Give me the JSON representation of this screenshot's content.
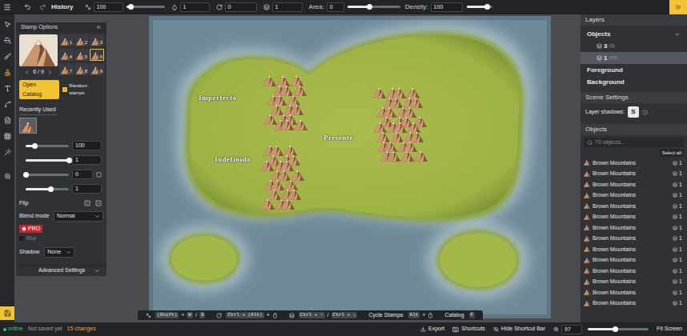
{
  "toolbar": {
    "history": "History",
    "size": {
      "value": "100",
      "level": 0.12
    },
    "opacity": "1",
    "rotation": "0",
    "layer": "1",
    "area": {
      "label": "Area:",
      "value": "0",
      "level": 0.42
    },
    "density": {
      "label": "Density:",
      "value": "100",
      "level": 0.8
    }
  },
  "tools": [
    {
      "selected": false
    },
    {
      "selected": false
    },
    {
      "selected": false
    },
    {
      "selected": true
    },
    {
      "selected": false
    },
    {
      "selected": false
    },
    {
      "selected": false
    },
    {
      "selected": false
    },
    {
      "selected": false
    },
    {
      "selected": false
    }
  ],
  "stamp_options": {
    "title": "Stamp Options",
    "counter": "6 / 9",
    "stamps": [
      {
        "label": "1",
        "selected": false
      },
      {
        "label": "2",
        "selected": false
      },
      {
        "label": "3",
        "selected": false
      },
      {
        "label": "4",
        "selected": false
      },
      {
        "label": "5",
        "selected": false
      },
      {
        "label": "6",
        "selected": true
      },
      {
        "label": "7",
        "selected": false
      },
      {
        "label": "8",
        "selected": false
      },
      {
        "label": "9",
        "selected": false
      }
    ],
    "open_catalog": "Open Catalog",
    "random_stamps": {
      "label": "Random stamps",
      "checked": true
    },
    "recently_used": "Recently Used",
    "size": {
      "value": "100",
      "level": 0.2
    },
    "opacity": {
      "value": "1",
      "level": 1
    },
    "rotation": {
      "value": "0",
      "level": 0
    },
    "layer": {
      "value": "1",
      "level": 0.58
    },
    "flip": "Flip",
    "blend_mode": {
      "label": "Blend mode",
      "value": "Normal"
    },
    "pro": "PRO",
    "blur": {
      "label": "Blur",
      "checked": false,
      "disabled": true
    },
    "shadow": {
      "label": "Shadow",
      "value": "None"
    },
    "advanced": "Advanced Settings"
  },
  "map": {
    "labels": [
      {
        "text": "Imperfecto"
      },
      {
        "text": "Presente"
      },
      {
        "text": "Indefinido"
      }
    ]
  },
  "shortcut_bar": [
    {
      "tokens": [
        {
          "kind": "key",
          "text": "(Shift)"
        },
        {
          "kind": "sep",
          "text": "+"
        },
        {
          "kind": "key",
          "text": "W"
        },
        {
          "kind": "sep",
          "text": "/"
        },
        {
          "kind": "key",
          "text": "S"
        }
      ]
    },
    {
      "tokens": [
        {
          "kind": "key",
          "text": "Ctrl + (Alt)"
        },
        {
          "kind": "sep",
          "text": "+"
        },
        {
          "kind": "mouse",
          "text": ""
        }
      ]
    },
    {
      "tokens": [
        {
          "kind": "key",
          "text": "Ctrl + ↑"
        },
        {
          "kind": "sep",
          "text": "/"
        },
        {
          "kind": "key",
          "text": "Ctrl + ↓"
        }
      ]
    },
    {
      "tokens": [
        {
          "kind": "label",
          "text": "Cycle Stamps"
        },
        {
          "kind": "key",
          "text": "Alt"
        },
        {
          "kind": "sep",
          "text": "+"
        },
        {
          "kind": "mouse",
          "text": ""
        }
      ]
    },
    {
      "tokens": [
        {
          "kind": "label",
          "text": "Catalog"
        },
        {
          "kind": "key",
          "text": "F"
        }
      ]
    }
  ],
  "layers": {
    "title": "Layers",
    "groups": [
      {
        "name": "Objects",
        "expanded": true,
        "sublayers": [
          {
            "name": "3",
            "count": "(3)",
            "selected": false
          },
          {
            "name": "1",
            "count": "(70)",
            "selected": true
          }
        ]
      },
      {
        "name": "Foreground",
        "expanded": false,
        "sublayers": []
      },
      {
        "name": "Background",
        "expanded": false,
        "sublayers": []
      }
    ]
  },
  "scene_settings": {
    "title": "Scene Settings",
    "layer_shadows": "Layer shadows:",
    "shadow_key": "S"
  },
  "objects": {
    "title": "Objects",
    "search_placeholder": "70 objects...",
    "select_all": "Select all",
    "rows": [
      {
        "name": "Brown Mountains",
        "layer": "1"
      },
      {
        "name": "Brown Mountains",
        "layer": "1"
      },
      {
        "name": "Brown Mountains",
        "layer": "1"
      },
      {
        "name": "Brown Mountains",
        "layer": "1"
      },
      {
        "name": "Brown Mountains",
        "layer": "1"
      },
      {
        "name": "Brown Mountains",
        "layer": "1"
      },
      {
        "name": "Brown Mountains",
        "layer": "1"
      },
      {
        "name": "Brown Mountains",
        "layer": "1"
      },
      {
        "name": "Brown Mountains",
        "layer": "1"
      },
      {
        "name": "Brown Mountains",
        "layer": "1"
      },
      {
        "name": "Brown Mountains",
        "layer": "1"
      },
      {
        "name": "Brown Mountains",
        "layer": "1"
      },
      {
        "name": "Brown Mountains",
        "layer": "1"
      },
      {
        "name": "Brown Mountains",
        "layer": "1"
      }
    ]
  },
  "status": {
    "online": "online",
    "saved": "Not saved yet",
    "changes": "15 changes",
    "export": "Export",
    "shortcuts": "Shortcuts",
    "hide_shortcut_bar": "Hide Shortcut Bar",
    "zoom": {
      "value": "97",
      "level": 0.45
    },
    "fit_screen": "Fit Screen"
  }
}
